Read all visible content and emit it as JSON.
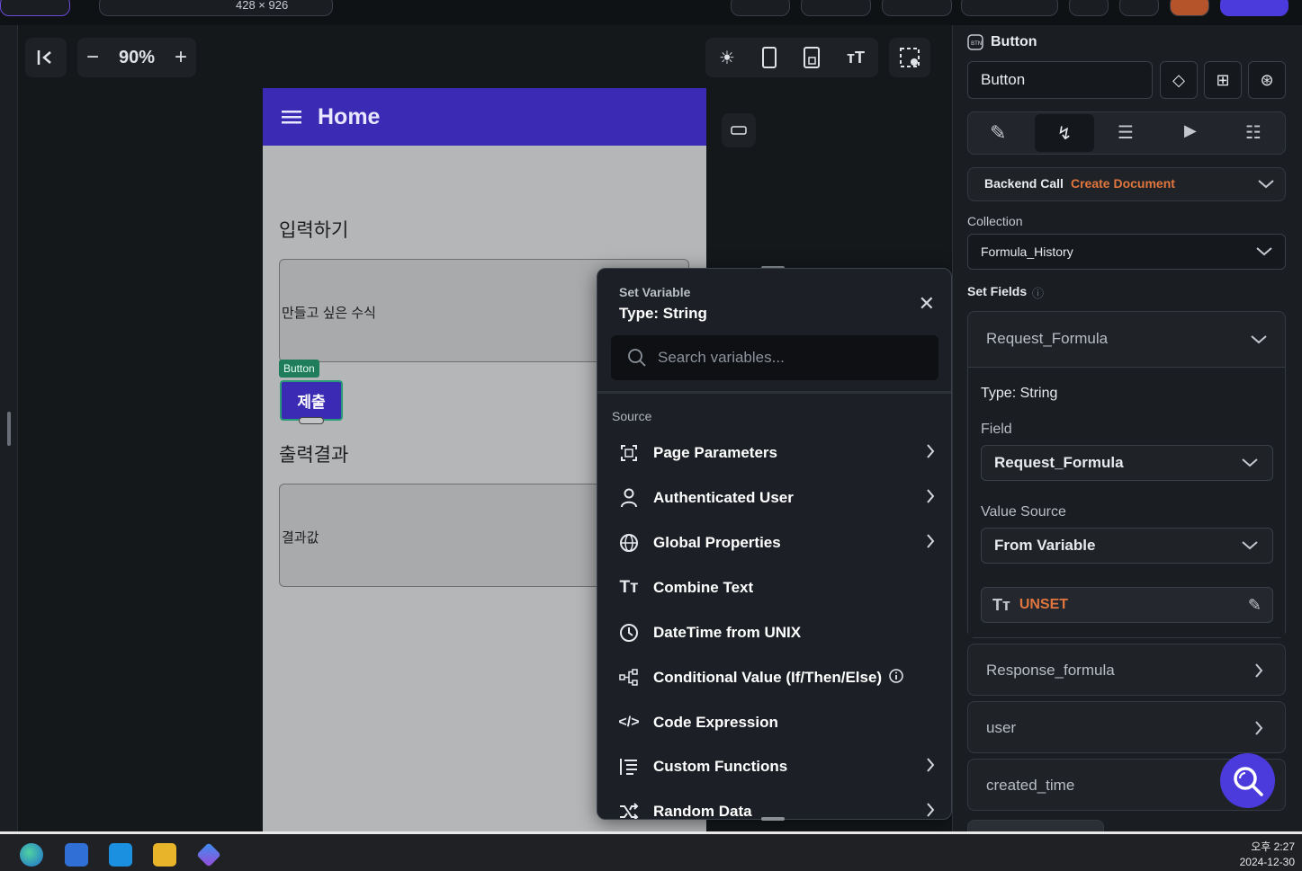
{
  "topbar": {
    "resolution": "428 × 926"
  },
  "canvas_toolbar": {
    "zoom": "90%"
  },
  "phone": {
    "appbar_title": "Home",
    "input_label": "입력하기",
    "input_hint": "만들고 싶은 수식",
    "button_tag": "Button",
    "submit_label": "제출",
    "output_label": "출력결과",
    "output_hint": "결과값"
  },
  "popup": {
    "title": "Set Variable",
    "type": "Type: String",
    "search_placeholder": "Search variables...",
    "source_label": "Source",
    "items": [
      {
        "label": "Page Parameters",
        "icon": "page-params-icon",
        "has_chevron": true
      },
      {
        "label": "Authenticated User",
        "icon": "user-icon",
        "has_chevron": true
      },
      {
        "label": "Global Properties",
        "icon": "globe-icon",
        "has_chevron": true
      },
      {
        "label": "Combine Text",
        "icon": "text-icon",
        "has_chevron": false
      },
      {
        "label": "DateTime from UNIX",
        "icon": "clock-icon",
        "has_chevron": false
      },
      {
        "label": "Conditional Value (If/Then/Else)",
        "icon": "conditional-icon",
        "has_chevron": false
      },
      {
        "label": "Code Expression",
        "icon": "code-icon",
        "has_chevron": false
      },
      {
        "label": "Custom Functions",
        "icon": "functions-icon",
        "has_chevron": true
      },
      {
        "label": "Random Data",
        "icon": "shuffle-icon",
        "has_chevron": true
      }
    ]
  },
  "right_panel": {
    "widget_type": "Button",
    "widget_name": "Button",
    "backend_call": "Backend Call",
    "backend_action": "Create Document",
    "collection_label": "Collection",
    "collection_value": "Formula_History",
    "set_fields_label": "Set Fields",
    "field1_name": "Request_Formula",
    "type_label": "Type: String",
    "field_label": "Field",
    "field_value": "Request_Formula",
    "value_source_label": "Value Source",
    "value_source": "From Variable",
    "unset": "UNSET",
    "field2_name": "Response_formula",
    "field3_name": "user",
    "field4_name": "created_time"
  },
  "taskbar": {
    "time": "오후 2:27",
    "date": "2024-12-30"
  },
  "colors": {
    "accent": "#3b2ab3",
    "orange": "#e0763e",
    "fab": "#4b3bdd"
  }
}
